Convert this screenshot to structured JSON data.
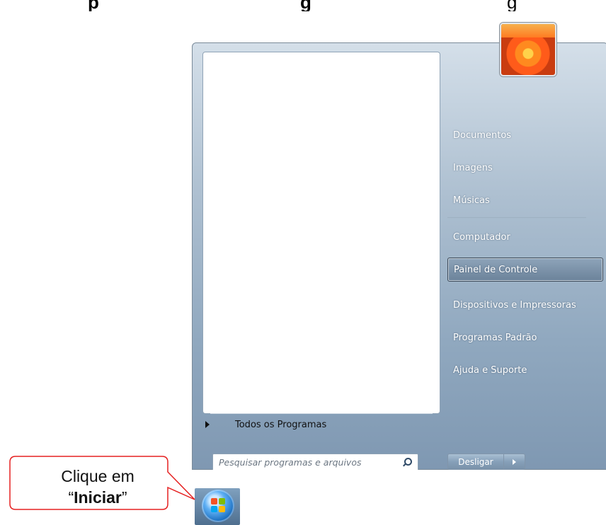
{
  "header_text": {
    "part1": "p",
    "part2": "g",
    "part3": "g"
  },
  "start_menu": {
    "all_programs_label": "Todos os Programas",
    "search": {
      "placeholder": "Pesquisar programas e arquivos",
      "icon": "search-icon"
    },
    "right_items": [
      {
        "label": "Documentos"
      },
      {
        "label": "Imagens"
      },
      {
        "label": "Músicas"
      },
      {
        "label": "Computador"
      },
      {
        "label": "Painel de Controle",
        "selected": true
      },
      {
        "label": "Dispositivos e Impressoras"
      },
      {
        "label": "Programas Padrão"
      },
      {
        "label": "Ajuda e Suporte"
      }
    ],
    "shutdown_label": "Desligar"
  },
  "taskbar": {
    "start_icon": "windows-orb-icon"
  },
  "callout": {
    "line1": "Clique em",
    "quote_open": "“",
    "strong": "Iniciar",
    "quote_close": "”",
    "border_color": "#e52020"
  }
}
